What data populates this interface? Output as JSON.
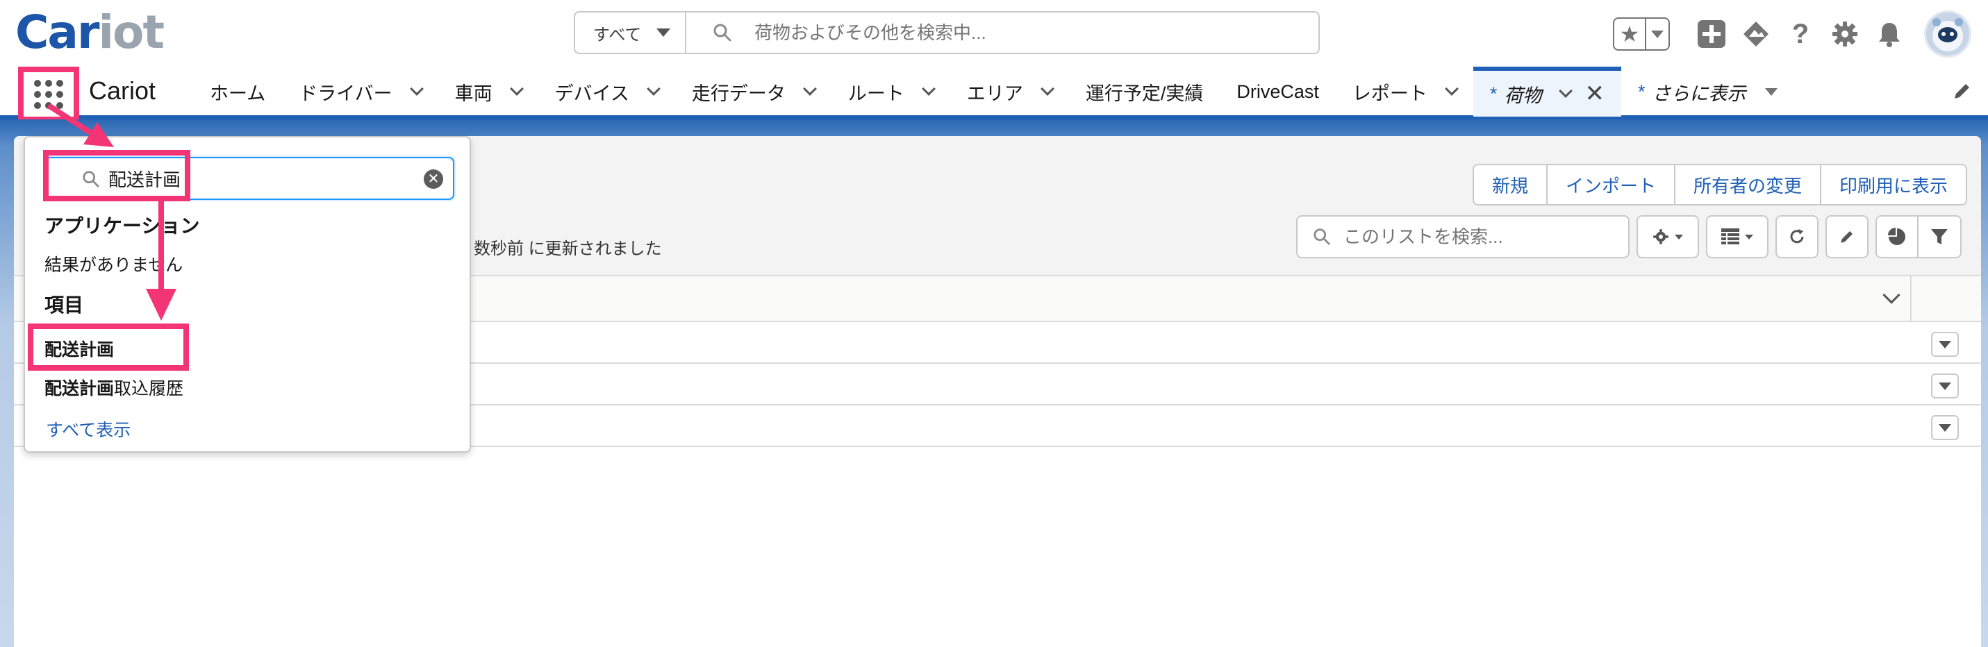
{
  "brand": {
    "logo_part1": "Car",
    "logo_part2": "iot",
    "app_name": "Cariot"
  },
  "global_search": {
    "scope": "すべて",
    "placeholder": "荷物およびその他を検索中..."
  },
  "nav": {
    "items": [
      {
        "label": "ホーム",
        "has_menu": false
      },
      {
        "label": "ドライバー",
        "has_menu": true
      },
      {
        "label": "車両",
        "has_menu": true
      },
      {
        "label": "デバイス",
        "has_menu": true
      },
      {
        "label": "走行データ",
        "has_menu": true
      },
      {
        "label": "ルート",
        "has_menu": true
      },
      {
        "label": "エリア",
        "has_menu": true
      },
      {
        "label": "運行予定/実績",
        "has_menu": false
      },
      {
        "label": "DriveCast",
        "has_menu": false
      },
      {
        "label": "レポート",
        "has_menu": true
      }
    ],
    "active_tab": {
      "prefix": "*",
      "label": "荷物"
    },
    "more_tab": {
      "prefix": "*",
      "label": "さらに表示"
    }
  },
  "list": {
    "buttons": [
      "新規",
      "インポート",
      "所有者の変更",
      "印刷用に表示"
    ],
    "status_text": "物・数秒前 に更新されました",
    "search_placeholder": "このリストを検索..."
  },
  "launcher": {
    "search_value": "配送計画",
    "apps_heading": "アプリケーション",
    "no_results": "結果がありません",
    "items_heading": "項目",
    "items": [
      {
        "bold": "配送計画",
        "rest": ""
      },
      {
        "bold": "配送計画",
        "rest": "取込履歴"
      }
    ],
    "show_all": "すべて表示"
  },
  "colors": {
    "brand_blue": "#1d55a8",
    "nav_accent": "#1f5fb5",
    "highlight": "#f43575",
    "link": "#1f5fb5"
  }
}
